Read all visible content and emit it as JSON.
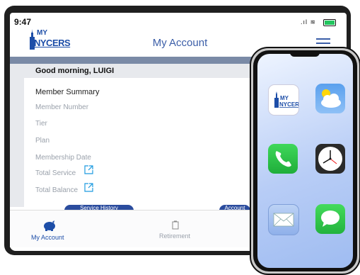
{
  "status_bar": {
    "time": "9:47"
  },
  "logo": {
    "line1": "MY",
    "line2": "NYCERS"
  },
  "header": {
    "title": "My Account"
  },
  "greeting": "Good morning, LUIGI",
  "member_summary": {
    "title": "Member Summary",
    "fields": [
      "Member Number",
      "Tier",
      "Plan",
      "Membership Date",
      "Total Service",
      "Total Balance"
    ]
  },
  "buttons": {
    "left": "Service History",
    "right": "Account"
  },
  "bottom_nav": [
    {
      "label": "My Account",
      "icon": "piggy-bank-icon",
      "active": true
    },
    {
      "label": "Retirement",
      "icon": "document-icon",
      "active": false
    }
  ],
  "phone_apps": [
    "nycers-app-icon",
    "weather-app-icon",
    "phone-app-icon",
    "clock-app-icon",
    "mail-app-icon",
    "messages-app-icon"
  ],
  "colors": {
    "brand": "#1d4ea8",
    "accent": "#3b5ea8",
    "link": "#1e9be0"
  }
}
